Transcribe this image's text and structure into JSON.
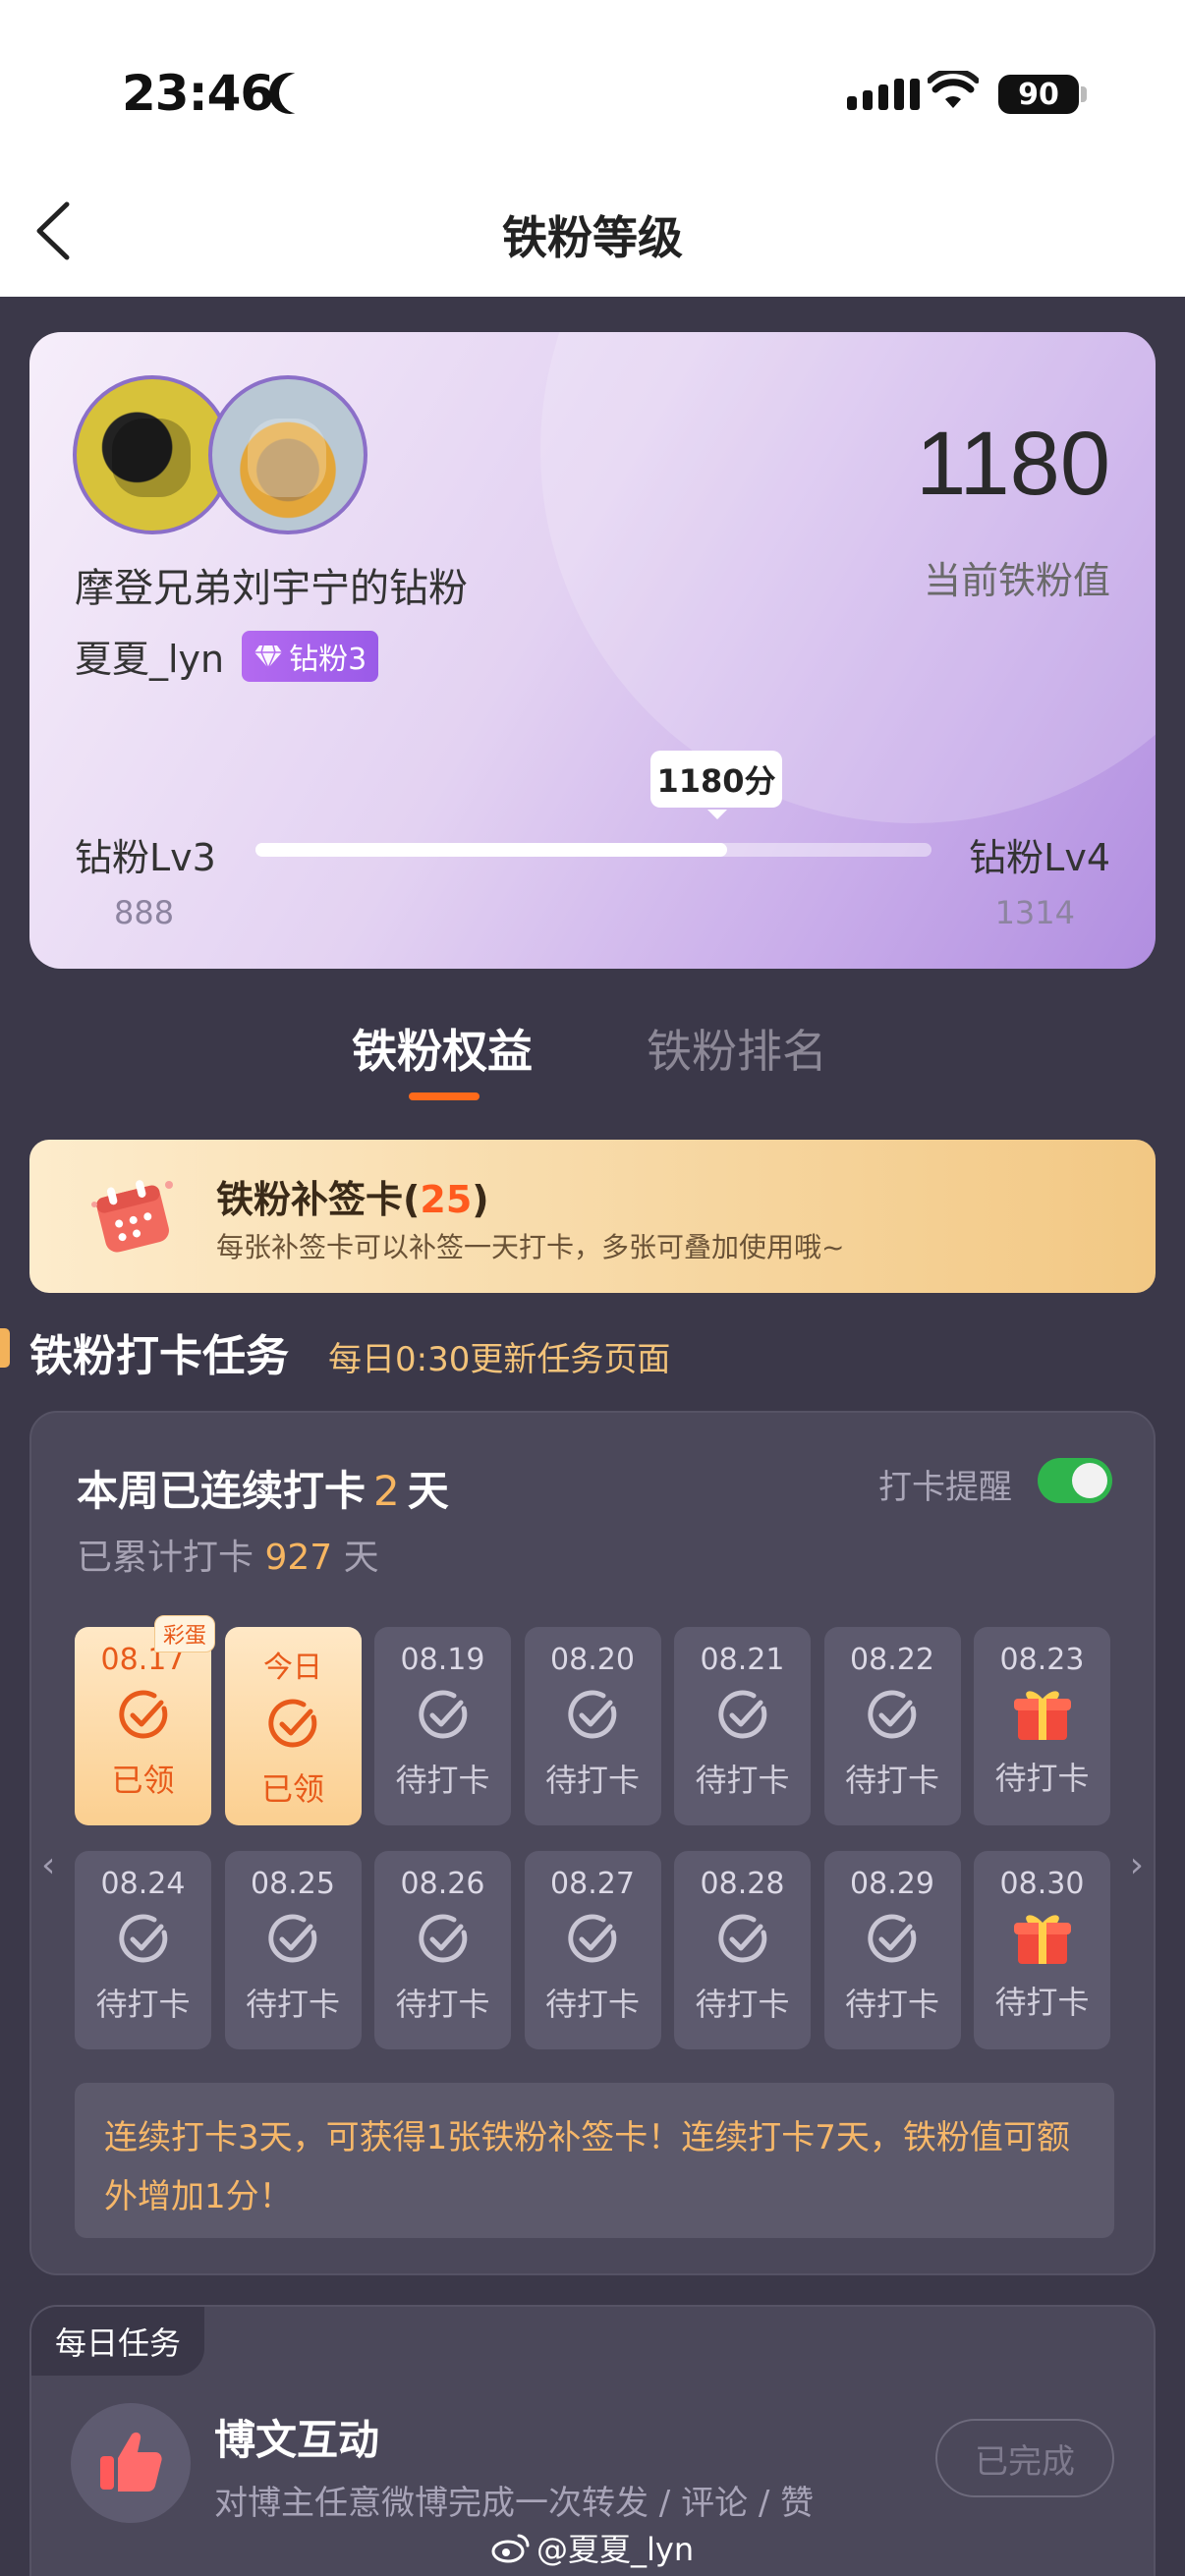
{
  "status_bar": {
    "time": "23:46",
    "battery": "90"
  },
  "nav": {
    "title": "铁粉等级"
  },
  "profile": {
    "fan_title": "摩登兄弟刘宇宁的钻粉",
    "username": "夏夏_lyn",
    "badge": "钻粉3",
    "score": "1180",
    "score_label": "当前铁粉值",
    "progress_bubble": "1180分",
    "level_left": "钻粉Lv3",
    "level_right": "钻粉Lv4",
    "threshold_left": "888",
    "threshold_right": "1314",
    "progress_fraction": 0.698
  },
  "tabs": [
    {
      "label": "铁粉权益",
      "active": true
    },
    {
      "label": "铁粉排名",
      "active": false
    }
  ],
  "supplement": {
    "title": "铁粉补签卡(",
    "count": "25",
    "title_end": ")",
    "desc": "每张补签卡可以补签一天打卡，多张可叠加使用哦~"
  },
  "section": {
    "title": "铁粉打卡任务",
    "subtitle": "每日0:30更新任务页面"
  },
  "checkin": {
    "streak_prefix": "本周已连续打卡",
    "streak_days": "2",
    "streak_suffix": "天",
    "total_prefix": "已累计打卡",
    "total_days": "927",
    "total_suffix": "天",
    "remind_label": "打卡提醒",
    "remind_on": true,
    "days": [
      {
        "date": "08.17",
        "status": "已领",
        "done": true,
        "egg": "彩蛋",
        "icon": "check-icon"
      },
      {
        "date": "今日",
        "status": "已领",
        "done": true,
        "icon": "check-icon"
      },
      {
        "date": "08.19",
        "status": "待打卡",
        "done": false,
        "icon": "check-icon"
      },
      {
        "date": "08.20",
        "status": "待打卡",
        "done": false,
        "icon": "check-icon"
      },
      {
        "date": "08.21",
        "status": "待打卡",
        "done": false,
        "icon": "check-icon"
      },
      {
        "date": "08.22",
        "status": "待打卡",
        "done": false,
        "icon": "check-icon"
      },
      {
        "date": "08.23",
        "status": "待打卡",
        "done": false,
        "icon": "gift-icon"
      },
      {
        "date": "08.24",
        "status": "待打卡",
        "done": false,
        "icon": "check-icon"
      },
      {
        "date": "08.25",
        "status": "待打卡",
        "done": false,
        "icon": "check-icon"
      },
      {
        "date": "08.26",
        "status": "待打卡",
        "done": false,
        "icon": "check-icon"
      },
      {
        "date": "08.27",
        "status": "待打卡",
        "done": false,
        "icon": "check-icon"
      },
      {
        "date": "08.28",
        "status": "待打卡",
        "done": false,
        "icon": "check-icon"
      },
      {
        "date": "08.29",
        "status": "待打卡",
        "done": false,
        "icon": "check-icon"
      },
      {
        "date": "08.30",
        "status": "待打卡",
        "done": false,
        "icon": "gift-icon"
      }
    ],
    "tip": "连续打卡3天，可获得1张铁粉补签卡！连续打卡7天，铁粉值可额外增加1分！"
  },
  "daily": {
    "tag": "每日任务",
    "task_title": "博文互动",
    "task_desc": "对博主任意微博完成一次转发 / 评论 / 赞",
    "button": "已完成"
  },
  "watermark": "@夏夏_lyn",
  "colors": {
    "accent": "#ff6a1a",
    "highlight": "#f7b661",
    "toggle": "#2fb44c",
    "background": "#3b3849"
  }
}
